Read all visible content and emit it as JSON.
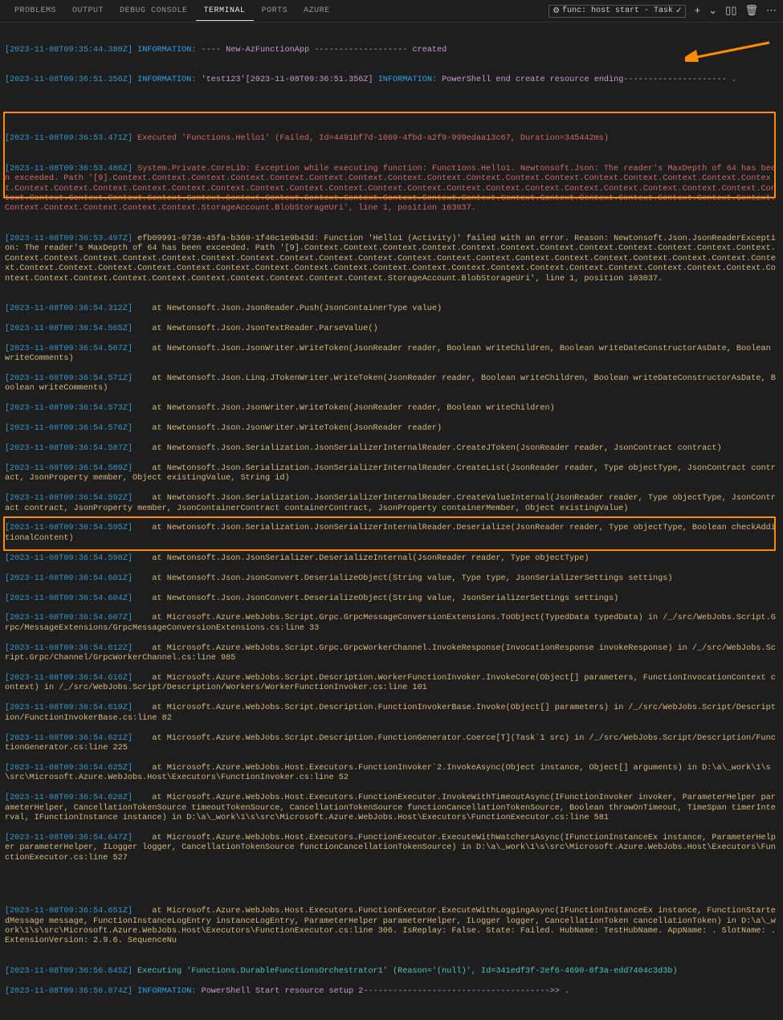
{
  "tabs": {
    "problems": "PROBLEMS",
    "output": "OUTPUT",
    "debug": "DEBUG CONSOLE",
    "terminal": "TERMINAL",
    "ports": "PORTS",
    "azure": "AZURE"
  },
  "toolbar": {
    "run_task": "func: host start - Task",
    "gear_glyph": "⚙",
    "check_glyph": "✓",
    "plus_glyph": "+",
    "chevron_glyph": "⌄",
    "split_glyph": "▯▯",
    "trash_glyph": "🗑",
    "more_glyph": "⋯"
  },
  "log": {
    "l1_ts": "[2023-11-08T09:35:44.380Z]",
    "l1_label": "INFORMATION:",
    "l1_text": "---- New-AzFunctionApp ------------------- created",
    "l2_ts": "[2023-11-08T09:36:51.356Z]",
    "l2_label": "INFORMATION:",
    "l2_mid": "'test123'[2023-11-08T09:36:51.356Z]",
    "l2_label2": "INFORMATION:",
    "l2_text": "PowerShell end create resource ending--------------------- .",
    "l3_ts": "[2023-11-08T09:36:53.471Z]",
    "l3_text": "Executed 'Functions.Hello1' (Failed, Id=4491bf7d-1669-4fbd-a2f9-999edaa13c67, Duration=345442ms)",
    "l4_ts": "[2023-11-08T09:36:53.486Z]",
    "l4_text": "System.Private.CoreLib: Exception while executing function: Functions.Hello1. Newtonsoft.Json: The reader's MaxDepth of 64 has been exceeded. Path '[9].Context.Context.Context.Context.Context.Context.Context.Context.Context.Context.Context.Context.Context.Context.Context.Context.Context.Context.Context.Context.Context.Context.Context.Context.Context.Context.Context.Context.Context.Context.Context.Context.Context.Context.Context.Context.Context.Context.Context.Context.Context.Context.Context.Context.Context.Context.Context.Context.Context.Context.Context.Context.Context.Context.Context.Context.Context.Context.Context.Context.Context.StorageAccount.BlobStorageUri', line 1, position 103037.",
    "l5_ts": "[2023-11-08T09:36:53.497Z]",
    "l5_text": "efb09991-0738-45fa-b360-1f40c1e9b43d: Function 'Hello1 (Activity)' failed with an error. Reason: Newtonsoft.Json.JsonReaderException: The reader's MaxDepth of 64 has been exceeded. Path '[9].Context.Context.Context.Context.Context.Context.Context.Context.Context.Context.Context.Context.Context.Context.Context.Context.Context.Context.Context.Context.Context.Context.Context.Context.Context.Context.Context.Context.Context.Context.Context.Context.Context.Context.Context.Context.Context.Context.Context.Context.Context.Context.Context.Context.Context.Context.Context.Context.Context.Context.Context.Context.Context.Context.Context.Context.Context.Context.Context.Context.Context.StorageAccount.BlobStorageUri', line 1, position 103037.",
    "l6_ts": "[2023-11-08T09:36:54.312Z]",
    "l6_text": "   at Newtonsoft.Json.JsonReader.Push(JsonContainerType value)",
    "l7_ts": "[2023-11-08T09:36:54.565Z]",
    "l7_text": "   at Newtonsoft.Json.JsonTextReader.ParseValue()",
    "l8_ts": "[2023-11-08T09:36:54.567Z]",
    "l8_text": "   at Newtonsoft.Json.JsonWriter.WriteToken(JsonReader reader, Boolean writeChildren, Boolean writeDateConstructorAsDate, Boolean writeComments)",
    "l9_ts": "[2023-11-08T09:36:54.571Z]",
    "l9_text": "   at Newtonsoft.Json.Linq.JTokenWriter.WriteToken(JsonReader reader, Boolean writeChildren, Boolean writeDateConstructorAsDate, Boolean writeComments)",
    "l10_ts": "[2023-11-08T09:36:54.573Z]",
    "l10_text": "   at Newtonsoft.Json.JsonWriter.WriteToken(JsonReader reader, Boolean writeChildren)",
    "l11_ts": "[2023-11-08T09:36:54.576Z]",
    "l11_text": "   at Newtonsoft.Json.JsonWriter.WriteToken(JsonReader reader)",
    "l12_ts": "[2023-11-08T09:36:54.587Z]",
    "l12_text": "   at Newtonsoft.Json.Serialization.JsonSerializerInternalReader.CreateJToken(JsonReader reader, JsonContract contract)",
    "l13_ts": "[2023-11-08T09:36:54.589Z]",
    "l13_text": "   at Newtonsoft.Json.Serialization.JsonSerializerInternalReader.CreateList(JsonReader reader, Type objectType, JsonContract contract, JsonProperty member, Object existingValue, String id)",
    "l14_ts": "[2023-11-08T09:36:54.592Z]",
    "l14_text": "   at Newtonsoft.Json.Serialization.JsonSerializerInternalReader.CreateValueInternal(JsonReader reader, Type objectType, JsonContract contract, JsonProperty member, JsonContainerContract containerContract, JsonProperty containerMember, Object existingValue)",
    "l15_ts": "[2023-11-08T09:36:54.595Z]",
    "l15_text": "   at Newtonsoft.Json.Serialization.JsonSerializerInternalReader.Deserialize(JsonReader reader, Type objectType, Boolean checkAdditionalContent)",
    "l16_ts": "[2023-11-08T09:36:54.598Z]",
    "l16_text": "   at Newtonsoft.Json.JsonSerializer.DeserializeInternal(JsonReader reader, Type objectType)",
    "l17_ts": "[2023-11-08T09:36:54.601Z]",
    "l17_text": "   at Newtonsoft.Json.JsonConvert.DeserializeObject(String value, Type type, JsonSerializerSettings settings)",
    "l18_ts": "[2023-11-08T09:36:54.604Z]",
    "l18_text": "   at Newtonsoft.Json.JsonConvert.DeserializeObject(String value, JsonSerializerSettings settings)",
    "l19_ts": "[2023-11-08T09:36:54.607Z]",
    "l19_text": "   at Microsoft.Azure.WebJobs.Script.Grpc.GrpcMessageConversionExtensions.ToObject(TypedData typedData) in /_/src/WebJobs.Script.Grpc/MessageExtensions/GrpcMessageConversionExtensions.cs:line 33",
    "l20_ts": "[2023-11-08T09:36:54.612Z]",
    "l20_text": "   at Microsoft.Azure.WebJobs.Script.Grpc.GrpcWorkerChannel.InvokeResponse(InvocationResponse invokeResponse) in /_/src/WebJobs.Script.Grpc/Channel/GrpcWorkerChannel.cs:line 985",
    "l21_ts": "[2023-11-08T09:36:54.616Z]",
    "l21_text": "   at Microsoft.Azure.WebJobs.Script.Description.WorkerFunctionInvoker.InvokeCore(Object[] parameters, FunctionInvocationContext context) in /_/src/WebJobs.Script/Description/Workers/WorkerFunctionInvoker.cs:line 101",
    "l22_ts": "[2023-11-08T09:36:54.619Z]",
    "l22_text": "   at Microsoft.Azure.WebJobs.Script.Description.FunctionInvokerBase.Invoke(Object[] parameters) in /_/src/WebJobs.Script/Description/FunctionInvokerBase.cs:line 82",
    "l23_ts": "[2023-11-08T09:36:54.621Z]",
    "l23_text": "   at Microsoft.Azure.WebJobs.Script.Description.FunctionGenerator.Coerce[T](Task`1 src) in /_/src/WebJobs.Script/Description/FunctionGenerator.cs:line 225",
    "l24_ts": "[2023-11-08T09:36:54.625Z]",
    "l24_text": "   at Microsoft.Azure.WebJobs.Host.Executors.FunctionInvoker`2.InvokeAsync(Object instance, Object[] arguments) in D:\\a\\_work\\1\\s\\src\\Microsoft.Azure.WebJobs.Host\\Executors\\FunctionInvoker.cs:line 52",
    "l25_ts": "[2023-11-08T09:36:54.628Z]",
    "l25_text": "   at Microsoft.Azure.WebJobs.Host.Executors.FunctionExecutor.InvokeWithTimeoutAsync(IFunctionInvoker invoker, ParameterHelper parameterHelper, CancellationTokenSource timeoutTokenSource, CancellationTokenSource functionCancellationTokenSource, Boolean throwOnTimeout, TimeSpan timerInterval, IFunctionInstance instance) in D:\\a\\_work\\1\\s\\src\\Microsoft.Azure.WebJobs.Host\\Executors\\FunctionExecutor.cs:line 581",
    "l26_ts": "[2023-11-08T09:36:54.647Z]",
    "l26_text": "   at Microsoft.Azure.WebJobs.Host.Executors.FunctionExecutor.ExecuteWithWatchersAsync(IFunctionInstanceEx instance, ParameterHelper parameterHelper, ILogger logger, CancellationTokenSource functionCancellationTokenSource) in D:\\a\\_work\\1\\s\\src\\Microsoft.Azure.WebJobs.Host\\Executors\\FunctionExecutor.cs:line 527",
    "l27_ts": "[2023-11-08T09:36:54.651Z]",
    "l27_text": "   at Microsoft.Azure.WebJobs.Host.Executors.FunctionExecutor.ExecuteWithLoggingAsync(IFunctionInstanceEx instance, FunctionStartedMessage message, FunctionInstanceLogEntry instanceLogEntry, ParameterHelper parameterHelper, ILogger logger, CancellationToken cancellationToken) in D:\\a\\_work\\1\\s\\src\\Microsoft.Azure.WebJobs.Host\\Executors\\FunctionExecutor.cs:line 306. IsReplay: False. State: Failed. HubName: TestHubName. AppName: . SlotName: . ExtensionVersion: 2.9.6. SequenceNu",
    "l28_ts": "[2023-11-08T09:36:56.845Z]",
    "l28_text": "Executing 'Functions.DurableFunctionsOrchestrator1' (Reason='(null)', Id=341edf3f-2ef6-4690-8f3a-edd7404c3d3b)",
    "l29_ts": "[2023-11-08T09:36:56.874Z]",
    "l29_label": "INFORMATION:",
    "l29_text": "PowerShell Start resource setup 2-------------------------------------->> ."
  }
}
